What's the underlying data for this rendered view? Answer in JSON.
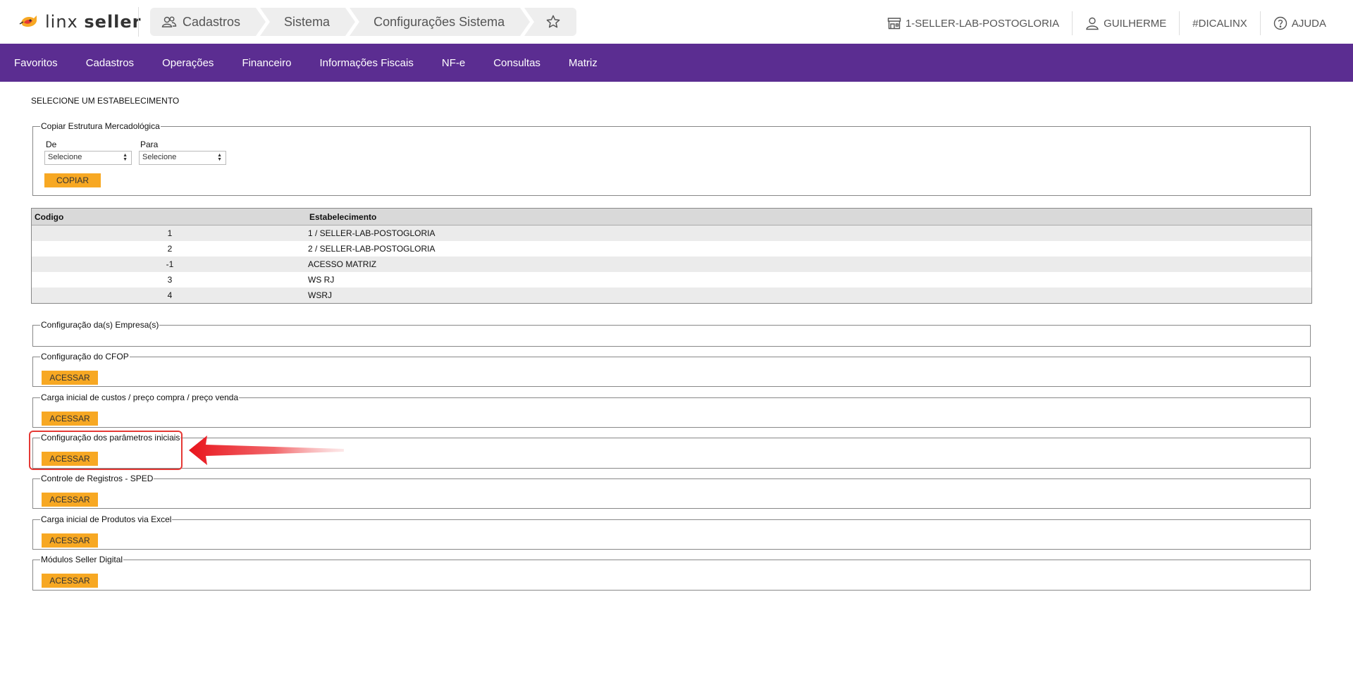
{
  "header": {
    "logo_text_light": "linx",
    "logo_text_bold": "seller",
    "breadcrumbs": [
      {
        "label": "Cadastros",
        "icon": "users-icon"
      },
      {
        "label": "Sistema"
      },
      {
        "label": "Configurações Sistema"
      }
    ],
    "favorite_icon": "star-icon",
    "store_label": "1-SELLER-LAB-POSTOGLORIA",
    "user_label": "GUILHERME",
    "tip_label": "#DICALINX",
    "help_label": "AJUDA"
  },
  "nav": {
    "items": [
      "Favoritos",
      "Cadastros",
      "Operações",
      "Financeiro",
      "Informações Fiscais",
      "NF-e",
      "Consultas",
      "Matriz"
    ]
  },
  "main": {
    "select_title": "SELECIONE UM ESTABELECIMENTO",
    "copy": {
      "legend": "Copiar Estrutura Mercadológica",
      "from_label": "De",
      "from_value": "Selecione",
      "to_label": "Para",
      "to_value": "Selecione",
      "button": "COPIAR"
    },
    "table": {
      "headers": [
        "Codigo",
        "Estabelecimento"
      ],
      "rows": [
        {
          "code": "1",
          "name": "1 / SELLER-LAB-POSTOGLORIA"
        },
        {
          "code": "2",
          "name": "2 / SELLER-LAB-POSTOGLORIA"
        },
        {
          "code": "-1",
          "name": "ACESSO MATRIZ"
        },
        {
          "code": "3",
          "name": "WS RJ"
        },
        {
          "code": "4",
          "name": "WSRJ"
        }
      ]
    },
    "sections": [
      {
        "legend": "Configuração da(s) Empresa(s)",
        "button": ""
      },
      {
        "legend": "Configuração do CFOP",
        "button": "ACESSAR"
      },
      {
        "legend": "Carga inicial de custos / preço compra / preço venda",
        "button": "ACESSAR"
      },
      {
        "legend": "Configuração dos parâmetros iniciais",
        "button": "ACESSAR"
      },
      {
        "legend": "Controle de Registros - SPED",
        "button": "ACESSAR"
      },
      {
        "legend": "Carga inicial de Produtos via Excel",
        "button": "ACESSAR"
      },
      {
        "legend": "Módulos Seller Digital",
        "button": "ACESSAR"
      }
    ]
  },
  "colors": {
    "nav_bg": "#5b2d91",
    "button_bg": "#f7a823",
    "annotation": "#e53935"
  }
}
